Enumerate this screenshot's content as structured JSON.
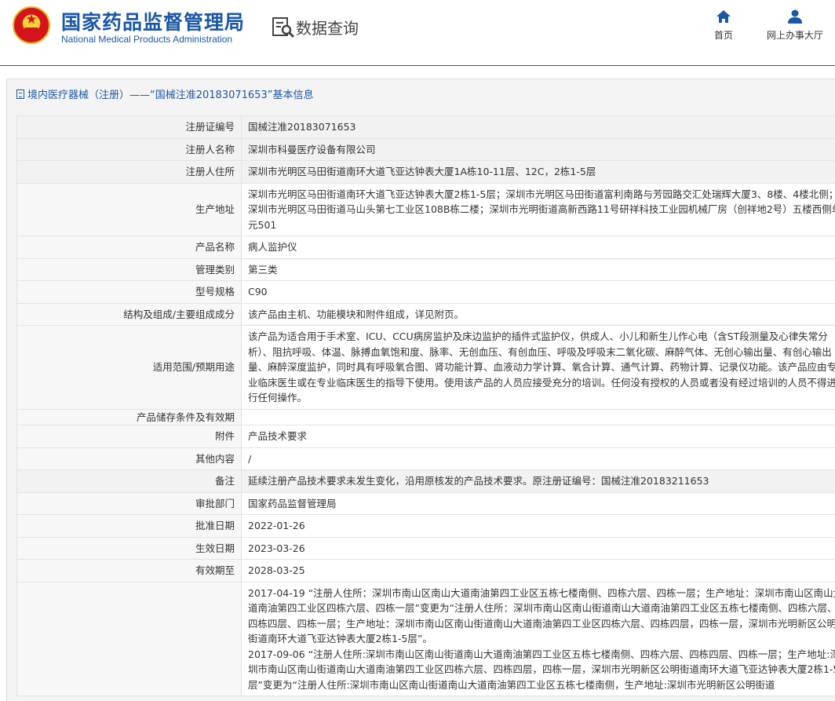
{
  "header": {
    "logo_cn": "国家药品监督管理局",
    "logo_en": "National Medical Products Administration",
    "section_title": "数据查询",
    "section_icon": "search-document-icon",
    "nav": [
      {
        "label": "首页",
        "icon": "home-icon"
      },
      {
        "label": "网上办事大厅",
        "icon": "user-icon"
      }
    ],
    "brand_color": "#1a57a5"
  },
  "panel": {
    "title": "境内医疗器械（注册）——“国械注准20183071653”基本信息"
  },
  "rows": [
    {
      "key": "注册证编号",
      "value": "国械注准20183071653"
    },
    {
      "key": "注册人名称",
      "value": "深圳市科曼医疗设备有限公司"
    },
    {
      "key": "注册人住所",
      "value": "深圳市光明区马田街道南环大道飞亚达钟表大厦1A栋10-11层、12C，2栋1-5层"
    },
    {
      "key": "生产地址",
      "value": "深圳市光明区马田街道南环大道飞亚达钟表大厦2栋1-5层；深圳市光明区马田街道富利南路与芳园路交汇处瑞辉大厦3、8楼、4楼北侧；深圳市光明区马田街道马山头第七工业区108B栋二楼；深圳市光明街道高新西路11号研祥科技工业园机械厂房（创祥地2号）五楼西侧单元501"
    },
    {
      "key": "产品名称",
      "value": "病人监护仪"
    },
    {
      "key": "管理类别",
      "value": "第三类"
    },
    {
      "key": "型号规格",
      "value": "C90"
    },
    {
      "key": "结构及组成/主要组成成分",
      "value": "该产品由主机、功能模块和附件组成，详见附页。"
    },
    {
      "key": "适用范围/预期用途",
      "value": "该产品为适合用于手术室、ICU、CCU病房监护及床边监护的插件式监护仪，供成人、小儿和新生儿作心电（含ST段测量及心律失常分析）、阻抗呼吸、体温、脉搏血氧饱和度、脉率、无创血压、有创血压、呼吸及呼吸末二氧化碳、麻醉气体、无创心输出量、有创心输出量、麻醉深度监护，同时具有呼吸氧合图、肾功能计算、血液动力学计算、氧合计算、通气计算、药物计算、记录仪功能。该产品应由专业临床医生或在专业临床医生的指导下使用。使用该产品的人员应接受充分的培训。任何没有授权的人员或者没有经过培训的人员不得进行任何操作。"
    },
    {
      "key": "产品储存条件及有效期",
      "value": ""
    },
    {
      "key": "附件",
      "value": "产品技术要求"
    },
    {
      "key": "其他内容",
      "value": "/"
    },
    {
      "key": "备注",
      "value": "延续注册产品技术要求未发生变化，沿用原核发的产品技术要求。原注册证编号：国械注准20183211653"
    },
    {
      "key": "审批部门",
      "value": "国家药品监督管理局"
    },
    {
      "key": "批准日期",
      "value": "2022-01-26"
    },
    {
      "key": "生效日期",
      "value": "2023-03-26"
    },
    {
      "key": "有效期至",
      "value": "2028-03-25"
    },
    {
      "key": "",
      "value": "2017-04-19 “注册人住所：深圳市南山区南山大道南油第四工业区五栋七楼南侧、四栋六层、四栋一层；生产地址：深圳市南山区南山大道南油第四工业区四栋六层、四栋一层”变更为“注册人住所：深圳市南山区南山街道南山大道南油第四工业区五栋七楼南侧、四栋六层、四栋四层、四栋一层；生产地址：深圳市南山区南山街道南山大道南油第四工业区四栋六层、四栋四层，四栋一层，深圳市光明新区公明街道南环大道飞亚达钟表大厦2栋1-5层”。",
      "value2": "2017-09-06 “注册人住所:深圳市南山区南山街道南山大道南油第四工业区五栋七楼南侧、四栋六层、四栋四层、四栋一层；生产地址:深圳市南山区南山街道南山大道南油第四工业区四栋六层、四栋四层，四栋一层，深圳市光明新区公明街道南环大道飞亚达钟表大厦2栋1-5层”变更为“注册人住所:深圳市南山区南山街道南山大道南油第四工业区五栋七楼南侧，生产地址:深圳市光明新区公明街道"
    }
  ]
}
